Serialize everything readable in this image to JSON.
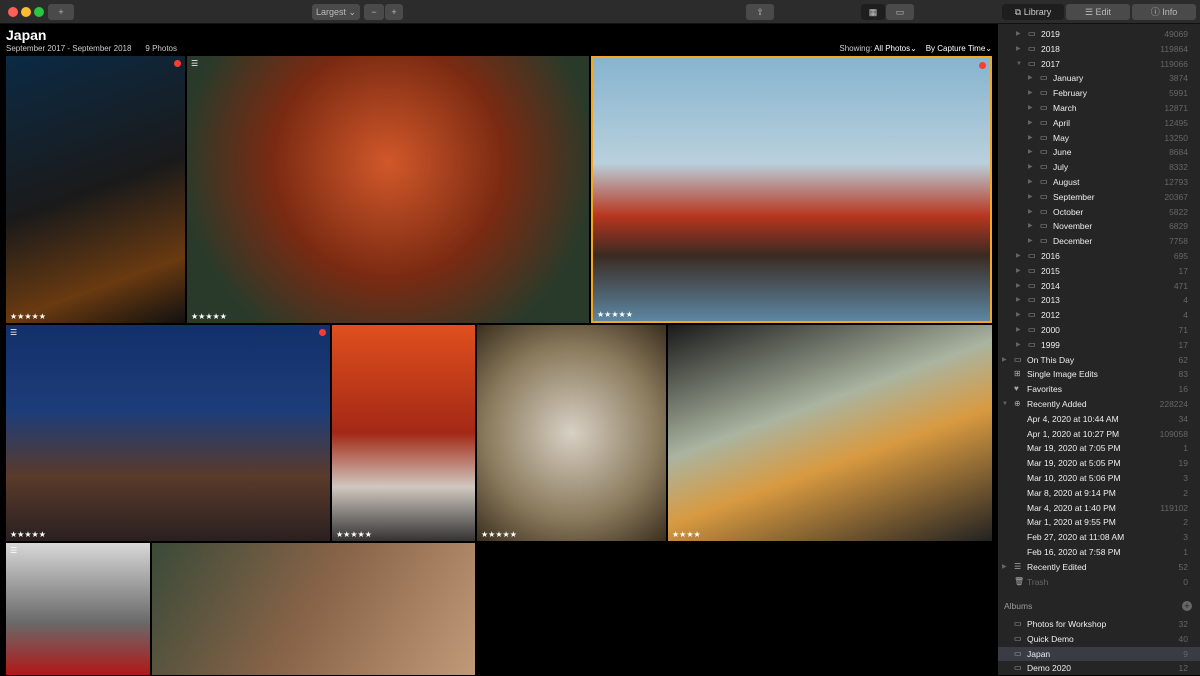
{
  "toolbar": {
    "add": "+",
    "size": "Largest ⌄",
    "zoom_out": "−",
    "zoom_in": "+",
    "share": "⇧",
    "grid_icon": "grid-icon",
    "single_icon": "single-view-icon",
    "tabs": [
      {
        "label": "Library",
        "icon": "library-icon"
      },
      {
        "label": "Edit",
        "icon": "sliders-icon"
      },
      {
        "label": "Info",
        "icon": "info-icon"
      }
    ]
  },
  "header": {
    "title": "Japan",
    "date_range": "September 2017 - September 2018",
    "count": "9 Photos",
    "showing_label": "Showing:",
    "showing_value": "All Photos⌄",
    "sort": "By Capture Time⌄"
  },
  "colors": {
    "accent": "#f5a623",
    "flag": "#ff3b30",
    "sidebar_bg": "#252525"
  },
  "photos": [
    {
      "stars": "★★★★★",
      "flag": true
    },
    {
      "stars": "★★★★★",
      "flag": false,
      "adjusted": true
    },
    {
      "stars": "★★★★★",
      "flag": true,
      "selected": true
    },
    {
      "stars": "★★★★★",
      "flag": true,
      "adjusted": true
    },
    {
      "stars": "★★★★★",
      "flag": false
    },
    {
      "stars": "★★★★★",
      "flag": false
    },
    {
      "stars": "★★★★",
      "flag": false
    },
    {
      "stars": "",
      "flag": false,
      "adjusted": true
    },
    {
      "stars": "",
      "flag": false
    }
  ],
  "sidebar": {
    "years": [
      {
        "label": "2019",
        "count": "49069"
      },
      {
        "label": "2018",
        "count": "119864"
      },
      {
        "label": "2017",
        "count": "119066"
      }
    ],
    "months": [
      {
        "label": "January",
        "count": "3874"
      },
      {
        "label": "February",
        "count": "5991"
      },
      {
        "label": "March",
        "count": "12871"
      },
      {
        "label": "April",
        "count": "12495"
      },
      {
        "label": "May",
        "count": "13250"
      },
      {
        "label": "June",
        "count": "8684"
      },
      {
        "label": "July",
        "count": "8332"
      },
      {
        "label": "August",
        "count": "12793"
      },
      {
        "label": "September",
        "count": "20367"
      },
      {
        "label": "October",
        "count": "5822"
      },
      {
        "label": "November",
        "count": "6829"
      },
      {
        "label": "December",
        "count": "7758"
      }
    ],
    "older_years": [
      {
        "label": "2016",
        "count": "695"
      },
      {
        "label": "2015",
        "count": "17"
      },
      {
        "label": "2014",
        "count": "471"
      },
      {
        "label": "2013",
        "count": "4"
      },
      {
        "label": "2012",
        "count": "4"
      },
      {
        "label": "2000",
        "count": "71"
      },
      {
        "label": "1999",
        "count": "17"
      }
    ],
    "special": [
      {
        "label": "On This Day",
        "count": "62",
        "icon": "calendar-icon",
        "glyph": "▭"
      },
      {
        "label": "Single Image Edits",
        "count": "83",
        "icon": "grid-icon",
        "glyph": "⊞"
      },
      {
        "label": "Favorites",
        "count": "16",
        "icon": "heart-icon",
        "glyph": "♥"
      },
      {
        "label": "Recently Added",
        "count": "228224",
        "icon": "plus-circle-icon",
        "glyph": "⊕"
      }
    ],
    "recent": [
      {
        "label": "Apr 4, 2020 at 10:44 AM",
        "count": "34"
      },
      {
        "label": "Apr 1, 2020 at 10:27 PM",
        "count": "109058"
      },
      {
        "label": "Mar 19, 2020 at 7:05 PM",
        "count": "1"
      },
      {
        "label": "Mar 19, 2020 at 5:05 PM",
        "count": "19"
      },
      {
        "label": "Mar 10, 2020 at 5:06 PM",
        "count": "3"
      },
      {
        "label": "Mar 8, 2020 at 9:14 PM",
        "count": "2"
      },
      {
        "label": "Mar 4, 2020 at 1:40 PM",
        "count": "119102"
      },
      {
        "label": "Mar 1, 2020 at 9:55 PM",
        "count": "2"
      },
      {
        "label": "Feb 27, 2020 at 11:08 AM",
        "count": "3"
      },
      {
        "label": "Feb 16, 2020 at 7:58 PM",
        "count": "1"
      }
    ],
    "bottom": [
      {
        "label": "Recently Edited",
        "count": "52",
        "icon": "sliders-icon",
        "glyph": "☰"
      },
      {
        "label": "Trash",
        "count": "0",
        "icon": "trash-icon",
        "glyph": "🗑"
      }
    ],
    "albums_header": "Albums",
    "albums": [
      {
        "label": "Photos for Workshop",
        "count": "32"
      },
      {
        "label": "Quick Demo",
        "count": "40"
      },
      {
        "label": "Japan",
        "count": "9",
        "selected": true
      },
      {
        "label": "Demo 2020",
        "count": "12"
      }
    ]
  }
}
